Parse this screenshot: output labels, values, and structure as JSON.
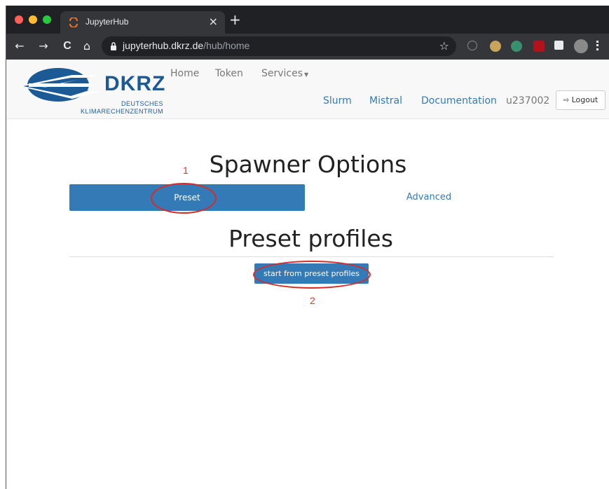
{
  "browser": {
    "tab_title": "JupyterHub",
    "tab_close": "×",
    "new_tab": "+",
    "url_host": "jupyterhub.dkrz.de",
    "url_path": "/hub/home",
    "back": "←",
    "forward": "→",
    "reload": "C",
    "home": "⌂",
    "star": "☆"
  },
  "logo": {
    "word": "DKRZ",
    "sub1": "DEUTSCHES",
    "sub2": "KLIMARECHENZENTRUM"
  },
  "nav": {
    "home": "Home",
    "token": "Token",
    "services": "Services",
    "slurm": "Slurm",
    "mistral": "Mistral",
    "documentation": "Documentation",
    "user": "u237002",
    "logout": "Logout"
  },
  "main": {
    "title": "Spawner Options",
    "tab_preset": "Preset",
    "tab_advanced": "Advanced",
    "section_title": "Preset profiles",
    "start_button": "start from preset profiles"
  },
  "annotations": {
    "num1": "1",
    "num2": "2",
    "color": "#d92b22"
  },
  "colors": {
    "brand": "#1c5a96",
    "primary": "#337ab7"
  }
}
